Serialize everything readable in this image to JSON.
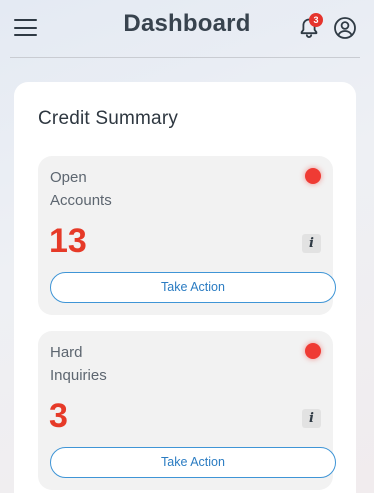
{
  "header": {
    "title": "Dashboard",
    "notification_count": "3"
  },
  "summary": {
    "title": "Credit Summary",
    "cards": [
      {
        "label_line1": "Open",
        "label_line2": "Accounts",
        "value": "13",
        "info_label": "i",
        "action_label": "Take Action",
        "status_color": "#ef3b34"
      },
      {
        "label_line1": "Hard",
        "label_line2": "Inquiries",
        "value": "3",
        "info_label": "i",
        "action_label": "Take Action",
        "status_color": "#ef3b34"
      }
    ]
  },
  "colors": {
    "accent_red": "#e63a28",
    "button_blue": "#3f95d6"
  }
}
